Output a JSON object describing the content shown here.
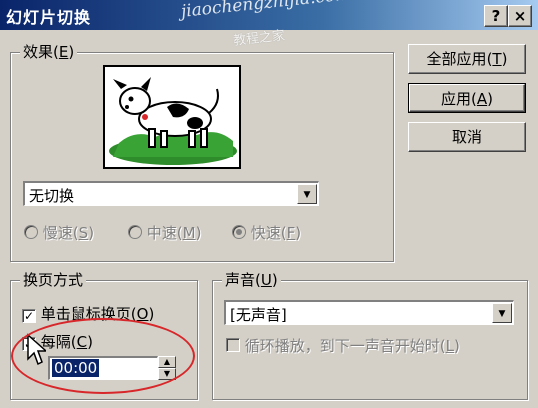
{
  "dialog": {
    "title": "幻灯片切换",
    "help_glyph": "?",
    "close_glyph": "×",
    "watermark_url": "jiaochengzhijia.com",
    "watermark_cn": "教程之家"
  },
  "effect": {
    "group_label": "效果",
    "group_key": "E",
    "preview_icon": "cow-picture",
    "transition_value": "无切换",
    "speed_options": [
      {
        "label": "慢速",
        "key": "S",
        "selected": false
      },
      {
        "label": "中速",
        "key": "M",
        "selected": false
      },
      {
        "label": "快速",
        "key": "F",
        "selected": true
      }
    ]
  },
  "buttons": {
    "apply_all": {
      "label": "全部应用",
      "key": "T"
    },
    "apply": {
      "label": "应用",
      "key": "A"
    },
    "cancel": {
      "label": "取消"
    }
  },
  "advance": {
    "group_label": "换页方式",
    "on_click": {
      "label": "单击鼠标换页",
      "key": "O",
      "checked": true
    },
    "every": {
      "label": "每隔",
      "key": "C",
      "checked": true
    },
    "time_value": "00:00"
  },
  "sound": {
    "group_label": "声音",
    "group_key": "U",
    "sound_value": "[无声音]",
    "loop": {
      "label": "循环播放，到下一声音开始时",
      "key": "L",
      "checked": false
    }
  },
  "colors": {
    "titlebar": "#0a246a",
    "face": "#d4d0c8",
    "highlight_circle": "#d8272a",
    "selection": "#0a246a"
  }
}
